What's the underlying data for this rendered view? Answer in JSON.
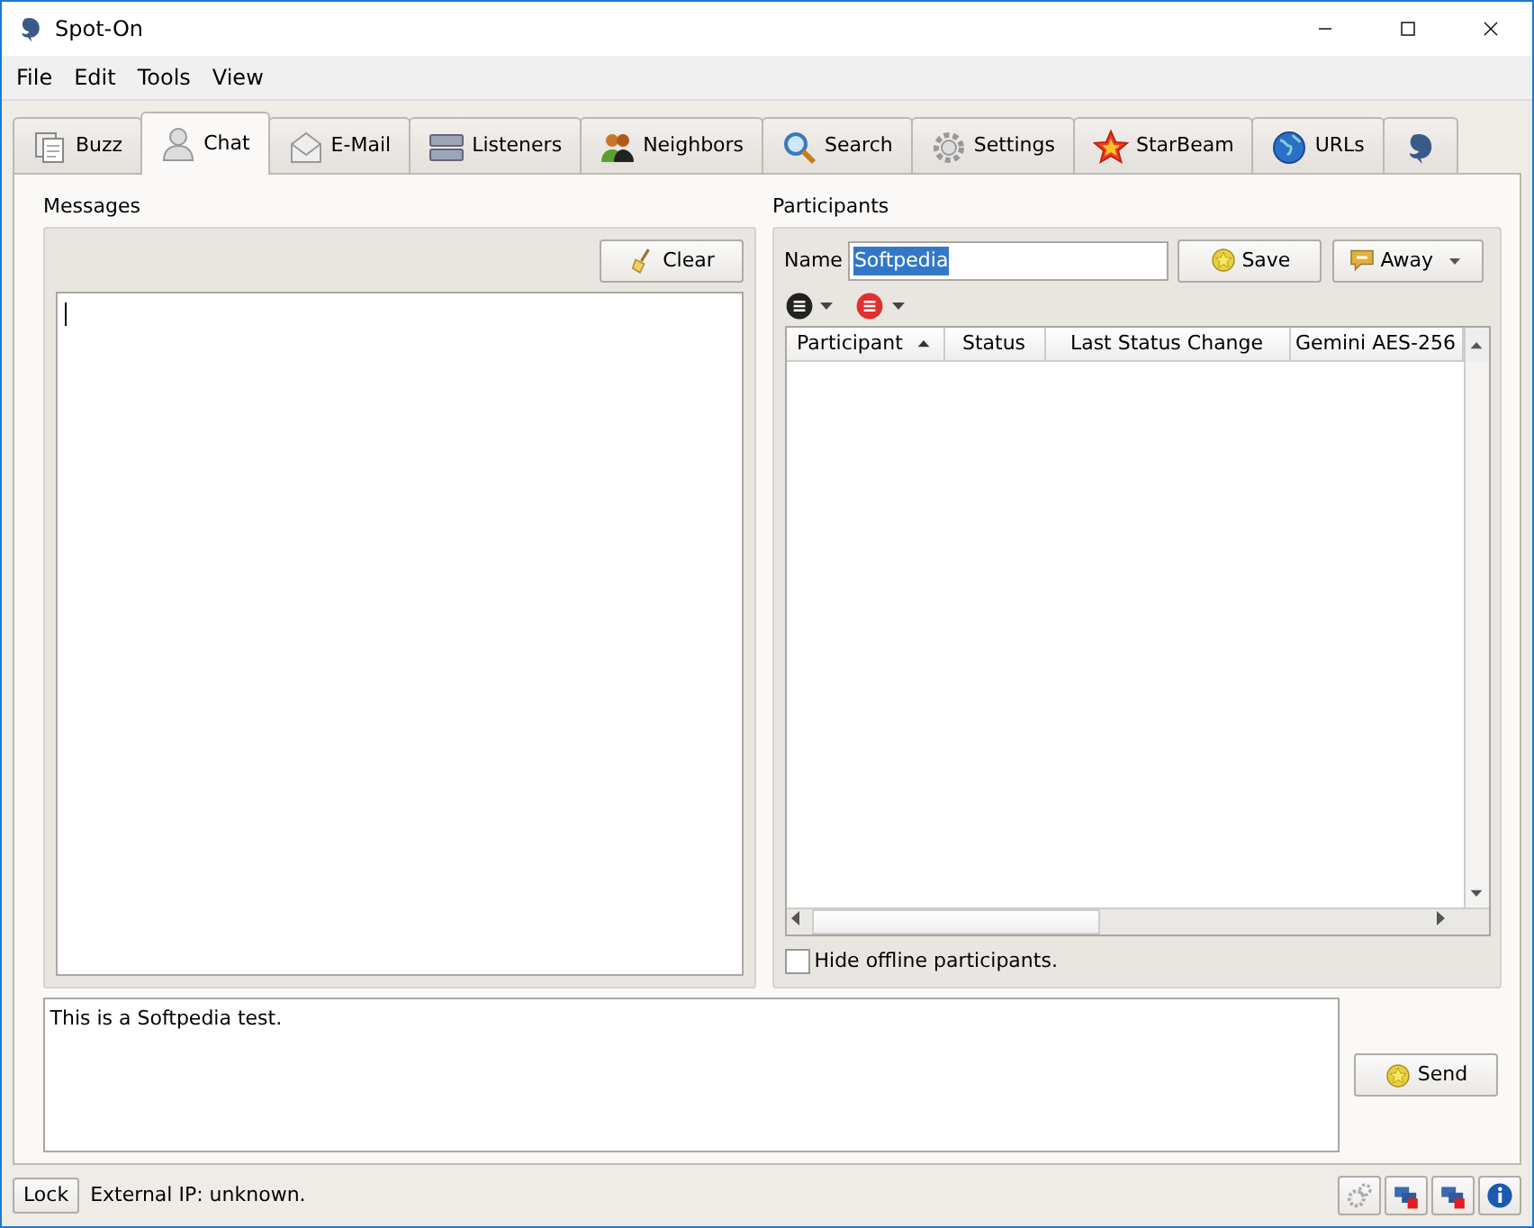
{
  "window": {
    "title": "Spot-On"
  },
  "menu": [
    "File",
    "Edit",
    "Tools",
    "View"
  ],
  "tabs": [
    {
      "label": "Buzz",
      "kind": "pages",
      "selected": false
    },
    {
      "label": "Chat",
      "kind": "person",
      "selected": true
    },
    {
      "label": "E-Mail",
      "kind": "mail",
      "selected": false
    },
    {
      "label": "Listeners",
      "kind": "drives",
      "selected": false
    },
    {
      "label": "Neighbors",
      "kind": "people",
      "selected": false
    },
    {
      "label": "Search",
      "kind": "magnifier",
      "selected": false
    },
    {
      "label": "Settings",
      "kind": "gear",
      "selected": false
    },
    {
      "label": "StarBeam",
      "kind": "star",
      "selected": false
    },
    {
      "label": "URLs",
      "kind": "globe",
      "selected": false
    },
    {
      "kind": "dolphin",
      "selected": false
    }
  ],
  "messages": {
    "title": "Messages",
    "clear_button": "Clear"
  },
  "participants": {
    "title": "Participants",
    "name_label": "Name",
    "name_value": "Softpedia",
    "save_button": "Save",
    "status_button": "Away",
    "columns": [
      {
        "label": "Participant",
        "sorted": true
      },
      {
        "label": "Status",
        "sorted": false
      },
      {
        "label": "Last Status Change",
        "sorted": false
      },
      {
        "label": "Gemini AES-256",
        "sorted": false
      }
    ],
    "hide_offline": {
      "label": "Hide offline participants.",
      "checked": false
    }
  },
  "compose": {
    "value": "This is a Softpedia test.",
    "send_button": "Send"
  },
  "status_bar": {
    "lock_button": "Lock",
    "external_ip": "External IP: unknown."
  }
}
